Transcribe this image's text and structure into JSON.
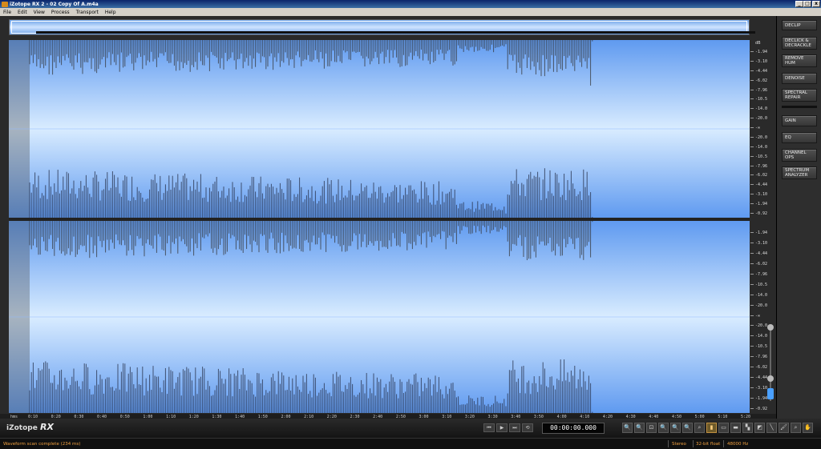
{
  "window": {
    "title": "iZotope RX 2 - 02 Copy Of A.m4a",
    "minimize": "_",
    "maximize": "□",
    "close": "x"
  },
  "menu": [
    "File",
    "Edit",
    "View",
    "Process",
    "Transport",
    "Help"
  ],
  "db_unit": "dB",
  "db_scale_top": [
    "-1.94",
    "-3.10",
    "-4.44",
    "-6.02",
    "-7.96",
    "-10.5",
    "-14.0",
    "-20.0",
    "-∞",
    "-20.0",
    "-14.0",
    "-10.5",
    "-7.96",
    "-6.02",
    "-4.44",
    "-3.10",
    "-1.94",
    "-0.92"
  ],
  "db_scale_bottom": [
    "-1.94",
    "-3.10",
    "-4.44",
    "-6.02",
    "-7.96",
    "-10.5",
    "-14.0",
    "-20.0",
    "-∞",
    "-20.0",
    "-14.0",
    "-10.5",
    "-7.96",
    "-6.02",
    "-4.44",
    "-3.10",
    "-1.94",
    "-0.92"
  ],
  "timeline": {
    "unit_label": "hms",
    "ticks": [
      "0:10",
      "0:20",
      "0:30",
      "0:40",
      "0:50",
      "1:00",
      "1:10",
      "1:20",
      "1:30",
      "1:40",
      "1:50",
      "2:00",
      "2:10",
      "2:20",
      "2:30",
      "2:40",
      "2:50",
      "3:00",
      "3:10",
      "3:20",
      "3:30",
      "3:40",
      "3:50",
      "4:00",
      "4:10",
      "4:20",
      "4:30",
      "4:40",
      "4:50",
      "5:00",
      "5:10",
      "5:20"
    ]
  },
  "modules": [
    {
      "label": "DECLIP"
    },
    {
      "label": "DECLICK & DECRACKLE"
    },
    {
      "label": "REMOVE HUM"
    },
    {
      "label": "DENOISE"
    },
    {
      "label": "SPECTRAL REPAIR"
    },
    {
      "label": "GAIN"
    },
    {
      "label": "EQ"
    },
    {
      "label": "CHANNEL OPS"
    },
    {
      "label": "SPECTRUM ANALYZER"
    }
  ],
  "logo": {
    "brand": "iZotope",
    "product": "RX"
  },
  "transport": {
    "buttons": [
      "⏮",
      "▶",
      "⏭",
      "⟲"
    ]
  },
  "timecode": "00:00:00.000",
  "tools": [
    "🔍",
    "🔍",
    "⊡",
    "🔍",
    "🔍",
    "🔍",
    "⌕",
    "▮",
    "▭",
    "▬",
    "▚",
    "◩",
    "╲",
    "🖌",
    "⌕",
    "✋"
  ],
  "status": {
    "message": "Waveform scan complete (234 ms)",
    "channels": "Stereo",
    "bitdepth": "32-bit float",
    "samplerate": "48000 Hz"
  },
  "colors": {
    "wave_blue": "#6aa6ff",
    "accent_orange": "#f0a040"
  }
}
